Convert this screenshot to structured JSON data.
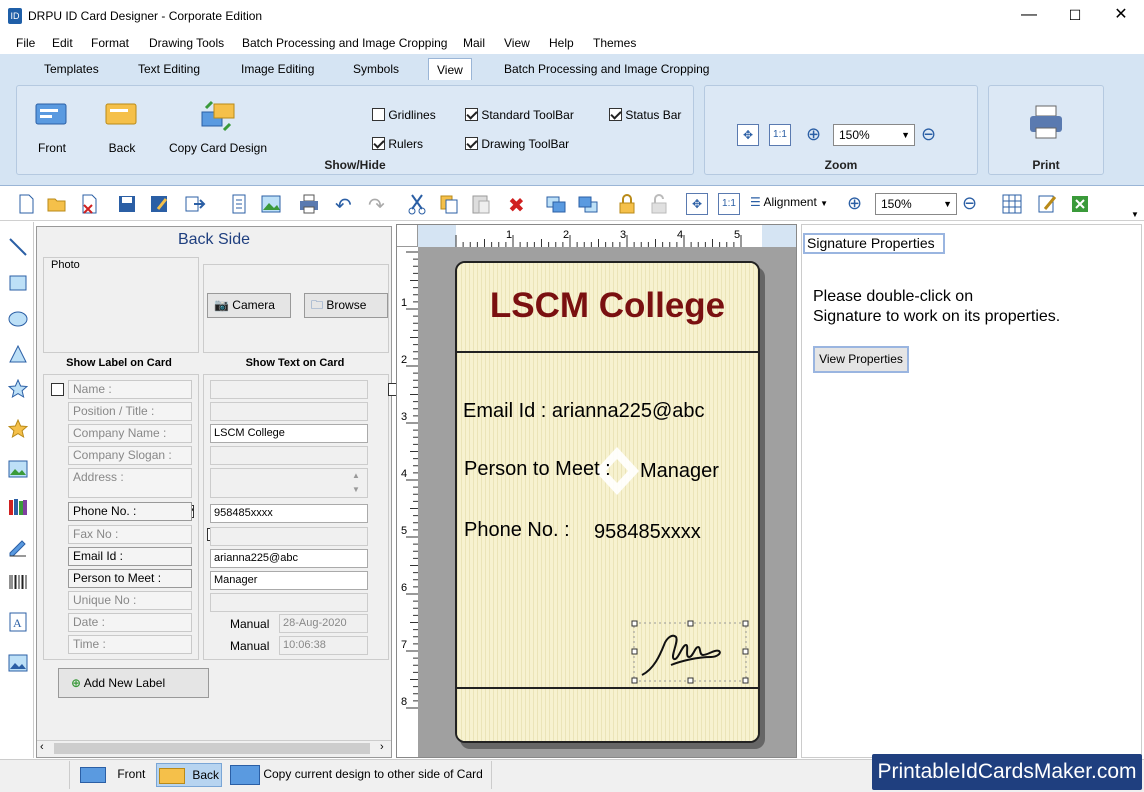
{
  "window": {
    "title": "DRPU ID Card Designer - Corporate Edition",
    "min": "—",
    "max": "☐",
    "close": "✕"
  },
  "menu": [
    "File",
    "Edit",
    "Format",
    "Drawing Tools",
    "Batch Processing and Image Cropping",
    "Mail",
    "View",
    "Help",
    "Themes"
  ],
  "ribbon_tabs": [
    "Templates",
    "Text Editing",
    "Image Editing",
    "Symbols",
    "View",
    "Batch Processing and Image Cropping"
  ],
  "ribbon": {
    "front": "Front",
    "back": "Back",
    "copy": "Copy Card Design",
    "gridlines": "Gridlines",
    "rulers": "Rulers",
    "standard_toolbar": "Standard ToolBar",
    "drawing_toolbar": "Drawing ToolBar",
    "status_bar": "Status Bar",
    "showhide": "Show/Hide",
    "zoom_value": "150%",
    "zoom_label": "Zoom",
    "print": "Print"
  },
  "toolbar": {
    "alignment": "Alignment",
    "zoom_value": "150%"
  },
  "panel": {
    "title": "Back Side",
    "photo": "Photo",
    "camera": "Camera",
    "browse": "Browse",
    "show_label": "Show Label on Card",
    "show_text": "Show Text on Card",
    "rows": [
      {
        "label": "Name :",
        "value": "",
        "label_on": false,
        "text_on": false
      },
      {
        "label": "Position / Title :",
        "value": "",
        "label_on": false,
        "text_on": false
      },
      {
        "label": "Company Name :",
        "value": "LSCM College",
        "label_on": false,
        "text_on": true
      },
      {
        "label": "Company Slogan :",
        "value": "",
        "label_on": false,
        "text_on": false
      },
      {
        "label": "Address :",
        "value": "",
        "label_on": false,
        "text_on": false
      },
      {
        "label": "Phone No. :",
        "value": "958485xxxx",
        "label_on": true,
        "text_on": true
      },
      {
        "label": "Fax No :",
        "value": "",
        "label_on": false,
        "text_on": false
      },
      {
        "label": "Email Id :",
        "value": "arianna225@abc",
        "label_on": true,
        "text_on": true
      },
      {
        "label": "Person to Meet :",
        "value": "Manager",
        "label_on": true,
        "text_on": true
      },
      {
        "label": "Unique No :",
        "value": "",
        "label_on": false,
        "text_on": false
      },
      {
        "label": "Date :",
        "value": "28-Aug-2020",
        "label_on": false,
        "text_on": false
      },
      {
        "label": "Time :",
        "value": "10:06:38",
        "label_on": false,
        "text_on": false
      }
    ],
    "manual": "Manual",
    "add_label": "Add New Label"
  },
  "ruler": {
    "top": [
      "1",
      "2",
      "3",
      "4",
      "5"
    ],
    "left": [
      "1",
      "2",
      "3",
      "4",
      "5",
      "6",
      "7",
      "8"
    ]
  },
  "card": {
    "college": "LSCM College",
    "email": "Email Id : arianna225@abc",
    "person_label": "Person to Meet :",
    "person_value": "Manager",
    "phone_label": "Phone No. :",
    "phone_value": "958485xxxx",
    "college_color": "#7a1010"
  },
  "sig": {
    "title": "Signature Properties",
    "line1": "Please double-click on",
    "line2": "Signature to work on its properties.",
    "button": "View Properties"
  },
  "status": {
    "front": "Front",
    "back": "Back",
    "copy": "Copy current design to other side of Card"
  },
  "watermark": "PrintableIdCardsMaker.com"
}
